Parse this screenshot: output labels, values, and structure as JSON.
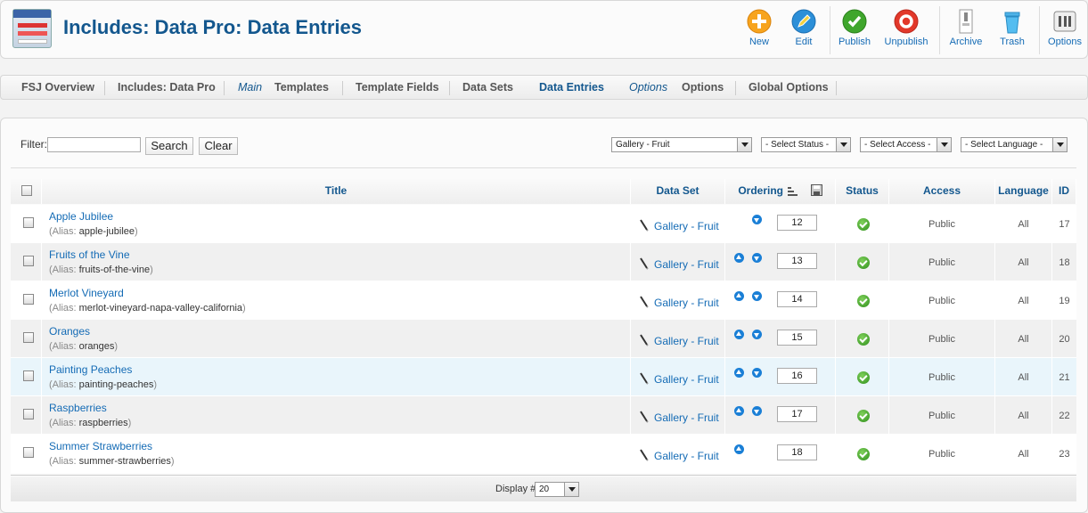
{
  "header": {
    "title": "Includes: Data Pro: Data Entries"
  },
  "toolbar": {
    "new": "New",
    "edit": "Edit",
    "publish": "Publish",
    "unpublish": "Unpublish",
    "archive": "Archive",
    "trash": "Trash",
    "options": "Options"
  },
  "subnav": {
    "fsj_overview": "FSJ Overview",
    "includes_data_pro": "Includes: Data Pro",
    "main": "Main",
    "templates": "Templates",
    "template_fields": "Template Fields",
    "data_sets": "Data Sets",
    "data_entries": "Data Entries",
    "options_italic": "Options",
    "options": "Options",
    "global_options": "Global Options"
  },
  "filter": {
    "label": "Filter:",
    "value": "",
    "search": "Search",
    "clear": "Clear",
    "gallery_select": "Gallery - Fruit",
    "status_select": "- Select Status -",
    "access_select": "- Select Access -",
    "language_select": "- Select Language -"
  },
  "table": {
    "headers": {
      "title": "Title",
      "data_set": "Data Set",
      "ordering": "Ordering",
      "status": "Status",
      "access": "Access",
      "language": "Language",
      "id": "ID"
    },
    "alias_prefix": "(Alias:",
    "alias_suffix": ")",
    "rows": [
      {
        "title": "Apple Jubilee",
        "alias": "apple-jubilee",
        "data_set": "Gallery - Fruit",
        "order": "12",
        "access": "Public",
        "language": "All",
        "id": "17"
      },
      {
        "title": "Fruits of the Vine",
        "alias": "fruits-of-the-vine",
        "data_set": "Gallery - Fruit",
        "order": "13",
        "access": "Public",
        "language": "All",
        "id": "18"
      },
      {
        "title": "Merlot Vineyard",
        "alias": "merlot-vineyard-napa-valley-california",
        "data_set": "Gallery - Fruit",
        "order": "14",
        "access": "Public",
        "language": "All",
        "id": "19"
      },
      {
        "title": "Oranges",
        "alias": "oranges",
        "data_set": "Gallery - Fruit",
        "order": "15",
        "access": "Public",
        "language": "All",
        "id": "20"
      },
      {
        "title": "Painting Peaches",
        "alias": "painting-peaches",
        "data_set": "Gallery - Fruit",
        "order": "16",
        "access": "Public",
        "language": "All",
        "id": "21"
      },
      {
        "title": "Raspberries",
        "alias": "raspberries",
        "data_set": "Gallery - Fruit",
        "order": "17",
        "access": "Public",
        "language": "All",
        "id": "22"
      },
      {
        "title": "Summer Strawberries",
        "alias": "summer-strawberries",
        "data_set": "Gallery - Fruit",
        "order": "18",
        "access": "Public",
        "language": "All",
        "id": "23"
      }
    ]
  },
  "footer": {
    "display_label": "Display #",
    "display_value": "20"
  },
  "colors": {
    "brand": "#13578e",
    "link": "#146bb5",
    "row_alt": "#f0f0f0",
    "row_highlight": "#e9f5fb"
  }
}
